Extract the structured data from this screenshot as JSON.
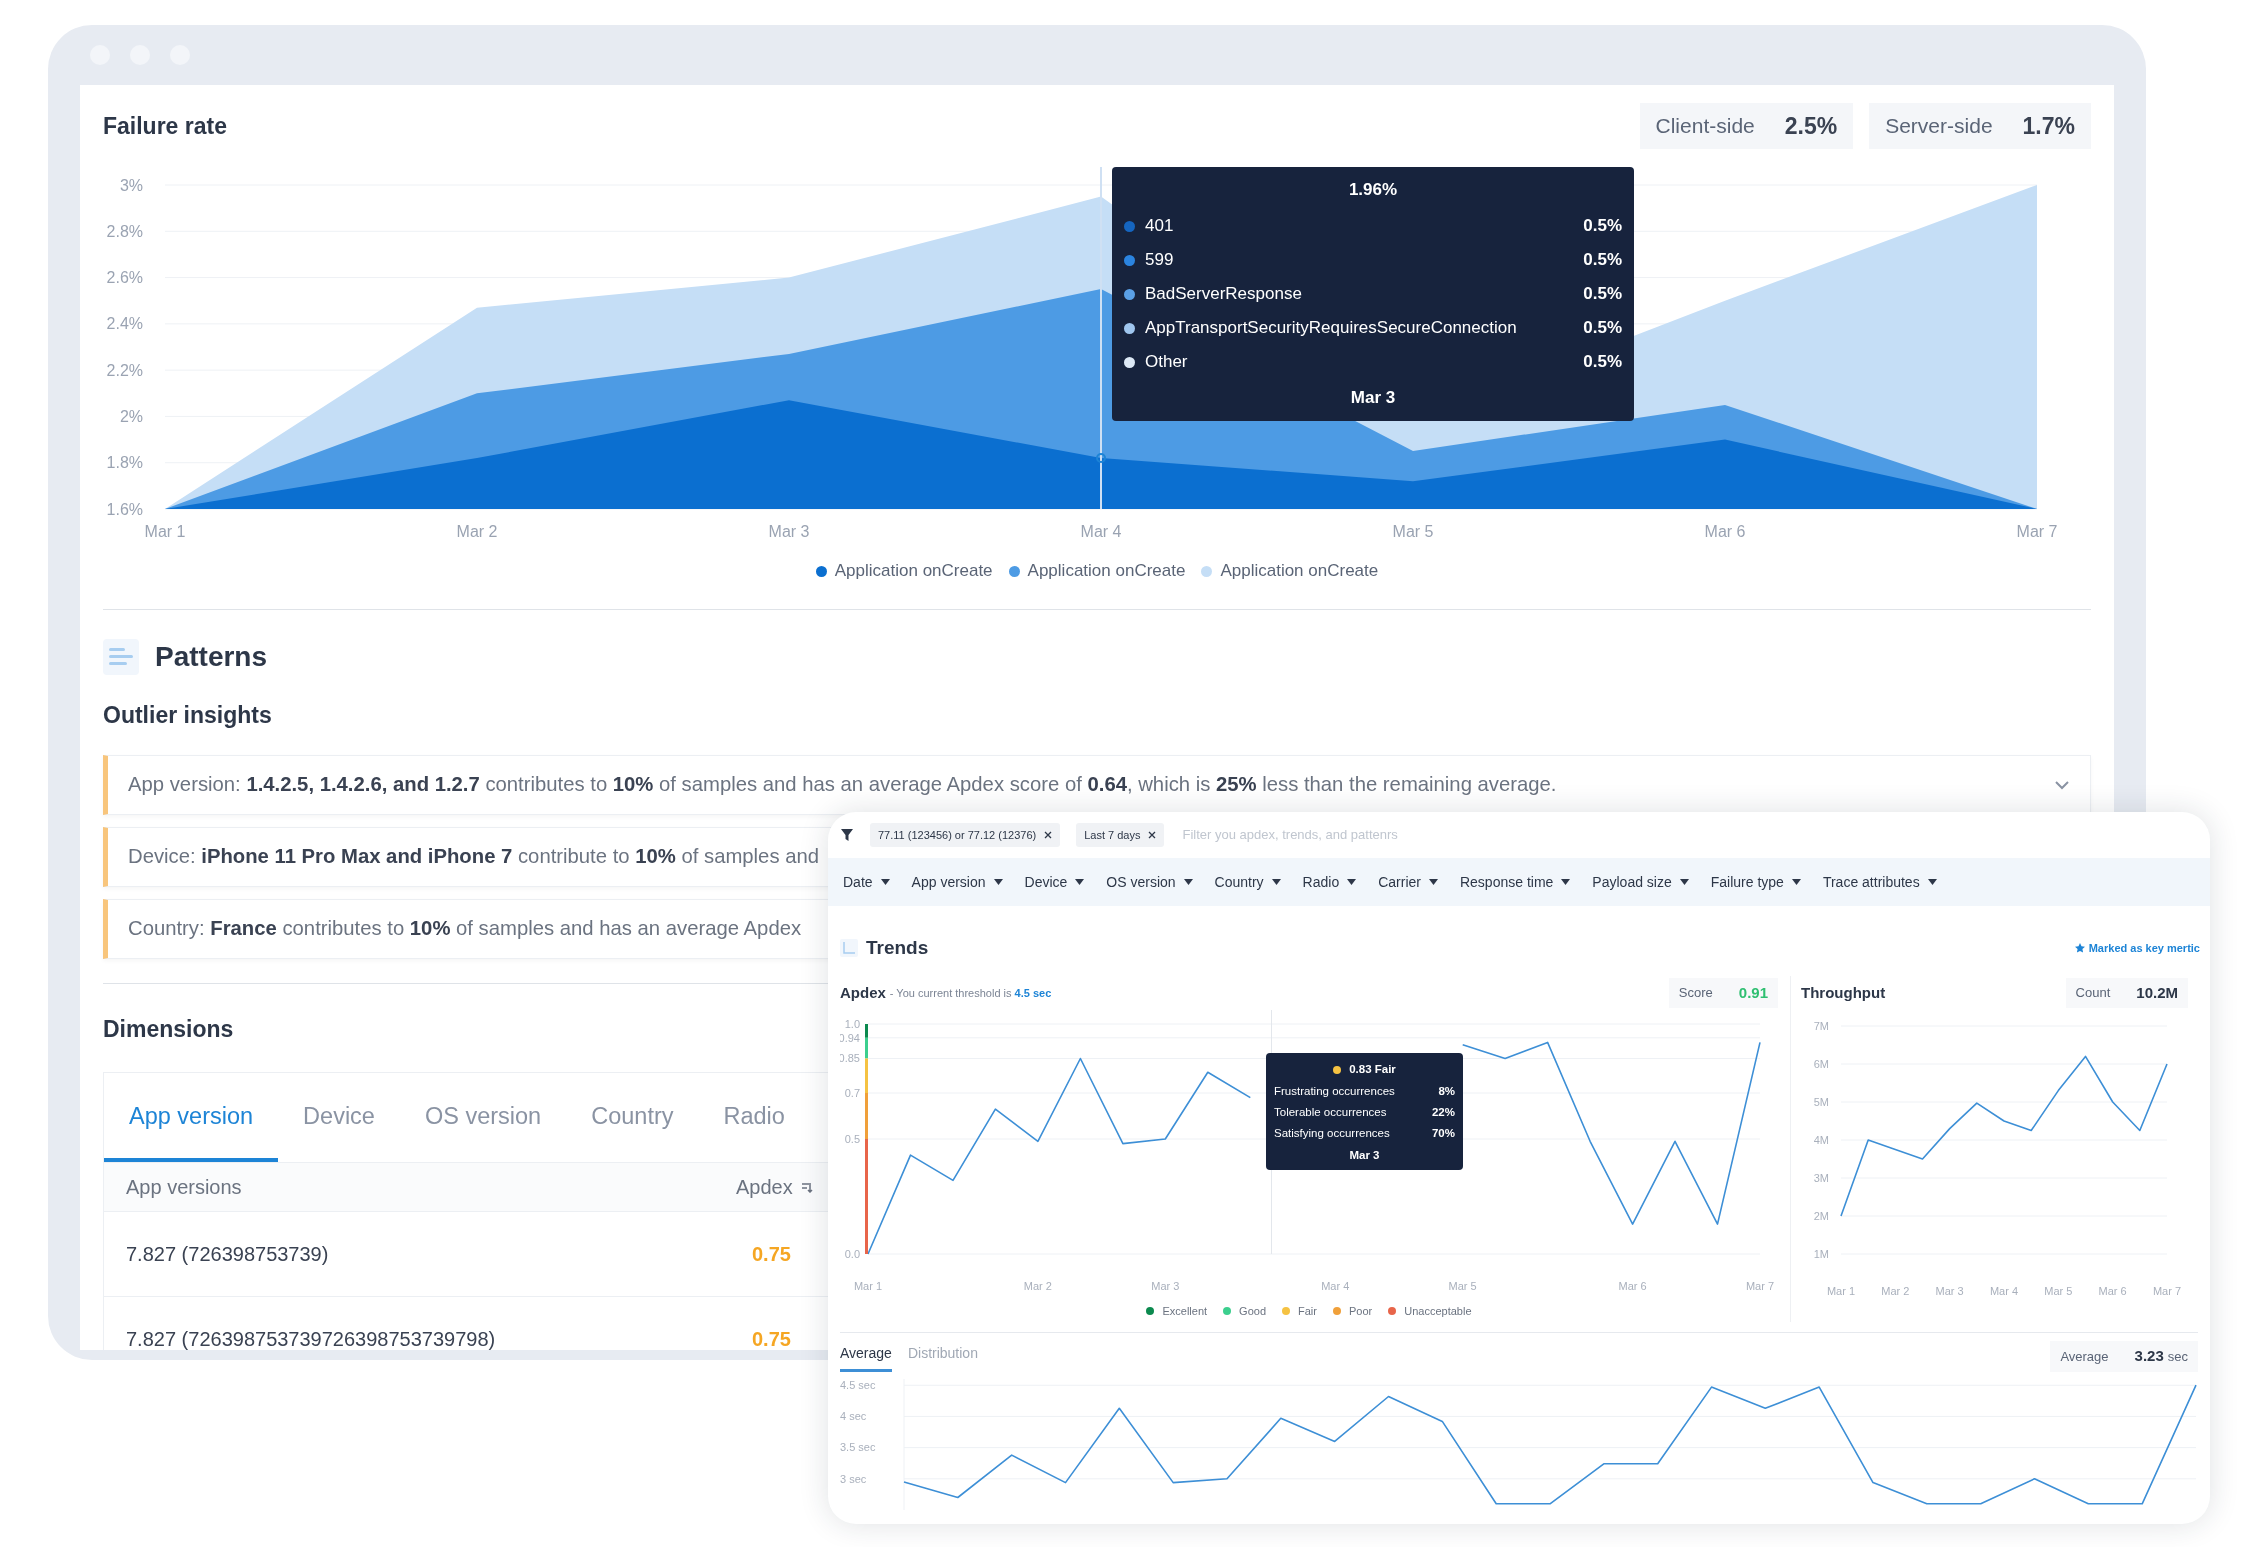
{
  "back_window": {
    "failure_rate": {
      "title": "Failure rate",
      "stats": [
        {
          "label": "Client-side",
          "value": "2.5%"
        },
        {
          "label": "Server-side",
          "value": "1.7%"
        }
      ],
      "chart_data": {
        "type": "area",
        "categories": [
          "Mar 1",
          "Mar 2",
          "Mar 3",
          "Mar 4",
          "Mar 5",
          "Mar 6",
          "Mar 7"
        ],
        "series": [
          {
            "name": "Application onCreate",
            "color": "#0b6fd0",
            "values": [
              1.6,
              1.82,
              2.07,
              1.82,
              1.72,
              1.9,
              1.6
            ]
          },
          {
            "name": "Application onCreate",
            "color": "#4d9be4",
            "values": [
              1.6,
              2.1,
              2.27,
              2.55,
              1.85,
              2.05,
              1.6
            ]
          },
          {
            "name": "Application onCreate",
            "color": "#c5def6",
            "values": [
              1.6,
              2.47,
              2.6,
              2.95,
              1.98,
              2.5,
              3.0
            ]
          }
        ],
        "ylim": [
          1.6,
          3.0
        ],
        "grid": true,
        "yticks": [
          {
            "value": 1.6,
            "label": "1.6%"
          },
          {
            "value": 1.8,
            "label": "1.8%"
          },
          {
            "value": 2.0,
            "label": "2%"
          },
          {
            "value": 2.2,
            "label": "2.2%"
          },
          {
            "value": 2.4,
            "label": "2.4%"
          },
          {
            "value": 2.6,
            "label": "2.6%"
          },
          {
            "value": 2.8,
            "label": "2.8%"
          },
          {
            "value": 3.0,
            "label": "3%"
          }
        ]
      },
      "tooltip": {
        "title": "1.96%",
        "items": [
          {
            "label": "401",
            "value": "0.5%",
            "color": "#1565c0"
          },
          {
            "label": "599",
            "value": "0.5%",
            "color": "#2b84e0"
          },
          {
            "label": "BadServerResponse",
            "value": "0.5%",
            "color": "#5aa0e6"
          },
          {
            "label": "AppTransportSecurityRequiresSecureConnection",
            "value": "0.5%",
            "color": "#9fc6ef"
          },
          {
            "label": "Other",
            "value": "0.5%",
            "color": "#dde9f6"
          }
        ],
        "date": "Mar 3"
      }
    },
    "patterns": {
      "title": "Patterns",
      "subtitle": "Outlier insights",
      "insights": [
        {
          "text": "App version: **1.4.2.5, 1.4.2.6, and 1.2.7**  contributes to **10%** of samples and has an average Apdex score of **0.64**, which is **25%** less than the remaining average.",
          "chevron": true
        },
        {
          "text": "Device: **iPhone 11 Pro Max and iPhone 7** contribute to **10%** of samples and",
          "chevron": false
        },
        {
          "text": "Country: **France** contributes to **10%** of samples and has an average Apdex",
          "chevron": false
        }
      ]
    },
    "dimensions": {
      "title": "Dimensions",
      "tabs": [
        {
          "label": "App version",
          "selected": true
        },
        {
          "label": "Device",
          "selected": false
        },
        {
          "label": "OS version",
          "selected": false
        },
        {
          "label": "Country",
          "selected": false
        },
        {
          "label": "Radio",
          "selected": false
        }
      ],
      "columns": [
        "App versions",
        "Apdex"
      ],
      "rows": [
        {
          "version": "7.827 (726398753739)",
          "apdex": "0.75"
        },
        {
          "version": "7.827 (726398753739726398753739798)",
          "apdex": "0.75"
        }
      ]
    }
  },
  "front_window": {
    "filters": [
      "77.11 (123456) or 77.12 (12376)",
      "Last 7 days"
    ],
    "search": {
      "placeholder": "Filter you apdex, trends, and pattenrs"
    },
    "dropdowns": [
      "Date",
      "App version",
      "Device",
      "OS version",
      "Country",
      "Radio",
      "Carrier",
      "Response time",
      "Payload size",
      "Failure type",
      "Trace attributes"
    ],
    "section_title": "Trends",
    "key_metric": "Marked as key mertic",
    "apdex": {
      "title": "Apdex",
      "note": "- You current threshold is",
      "threshold": "4.5 sec",
      "score_label": "Score",
      "score": "0.91",
      "chart_data": {
        "type": "line",
        "categories": [
          "Mar 1",
          null,
          null,
          null,
          "Mar 2",
          null,
          null,
          "Mar 3",
          null,
          null,
          null,
          "Mar 4",
          null,
          null,
          "Mar 5",
          null,
          null,
          null,
          "Mar 6",
          null,
          null,
          "Mar 7"
        ],
        "series": [
          {
            "color": "#3d8fd6",
            "values": [
              0,
              0.43,
              0.32,
              0.63,
              0.49,
              0.85,
              0.48,
              0.5,
              0.79,
              0.68,
              null,
              null,
              null,
              null,
              0.91,
              0.85,
              0.92,
              0.49,
              0.13,
              0.49,
              0.13,
              0.92
            ]
          }
        ],
        "ylim": [
          0,
          1
        ],
        "grid": true,
        "yticks": [
          {
            "value": 0,
            "label": "0.0"
          },
          {
            "value": 0.5,
            "label": "0.5"
          },
          {
            "value": 0.7,
            "label": "0.7"
          },
          {
            "value": 0.85,
            "label": "0.85"
          },
          {
            "value": 0.94,
            "label": "0.94"
          },
          {
            "value": 1,
            "label": "1.0"
          }
        ]
      },
      "tooltip": {
        "title": "0.83 Fair",
        "color": "#f5c242",
        "rows": [
          {
            "label": "Frustrating occurrences",
            "value": "8%"
          },
          {
            "label": "Tolerable occurrences",
            "value": "22%"
          },
          {
            "label": "Satisfying occurrences",
            "value": "70%"
          }
        ],
        "date": "Mar 3"
      },
      "legend": [
        {
          "label": "Excellent",
          "color": "#0c8a4f"
        },
        {
          "label": "Good",
          "color": "#3ccf8e"
        },
        {
          "label": "Fair",
          "color": "#f5c242"
        },
        {
          "label": "Poor",
          "color": "#f0a03a"
        },
        {
          "label": "Unacceptable",
          "color": "#e8654a"
        }
      ]
    },
    "throughput": {
      "title": "Throughput",
      "count_label": "Count",
      "count": "10.2M",
      "chart_data": {
        "type": "line",
        "categories": [
          "Mar 1",
          null,
          "Mar 2",
          null,
          "Mar 3",
          null,
          "Mar 4",
          null,
          "Mar 5",
          null,
          "Mar 6",
          null,
          "Mar 7"
        ],
        "series": [
          {
            "color": "#3d8fd6",
            "values": [
              2.0,
              4.0,
              3.75,
              3.5,
              4.3,
              4.97,
              4.5,
              4.25,
              5.3,
              6.2,
              5.0,
              4.25,
              6.0
            ]
          }
        ],
        "ylim": [
          1,
          7
        ],
        "grid": true,
        "yticks": [
          {
            "value": 1,
            "label": "1M"
          },
          {
            "value": 2,
            "label": "2M"
          },
          {
            "value": 3,
            "label": "3M"
          },
          {
            "value": 4,
            "label": "4M"
          },
          {
            "value": 5,
            "label": "5M"
          },
          {
            "value": 6,
            "label": "6M"
          },
          {
            "value": 7,
            "label": "7M"
          }
        ]
      }
    },
    "response_tabs": [
      {
        "label": "Average",
        "selected": true
      },
      {
        "label": "Distribution",
        "selected": false
      }
    ],
    "average": {
      "label": "Average",
      "value": "3.23",
      "unit": "sec",
      "chart_data": {
        "type": "line",
        "series": [
          {
            "color": "#3d8fd6",
            "values": [
              2.95,
              2.7,
              3.38,
              2.94,
              4.13,
              2.94,
              3.0,
              3.97,
              3.6,
              4.32,
              3.92,
              2.6,
              2.6,
              3.24,
              3.24,
              4.47,
              4.13,
              4.47,
              2.94,
              2.6,
              2.6,
              3.0,
              2.6,
              2.6,
              4.5
            ]
          }
        ],
        "ylim": [
          2.5,
          4.6
        ],
        "grid": true,
        "yticks": [
          {
            "value": 3,
            "label": "3 sec"
          },
          {
            "value": 3.5,
            "label": "3.5 sec"
          },
          {
            "value": 4,
            "label": "4 sec"
          },
          {
            "value": 4.5,
            "label": "4.5 sec"
          }
        ]
      }
    }
  }
}
